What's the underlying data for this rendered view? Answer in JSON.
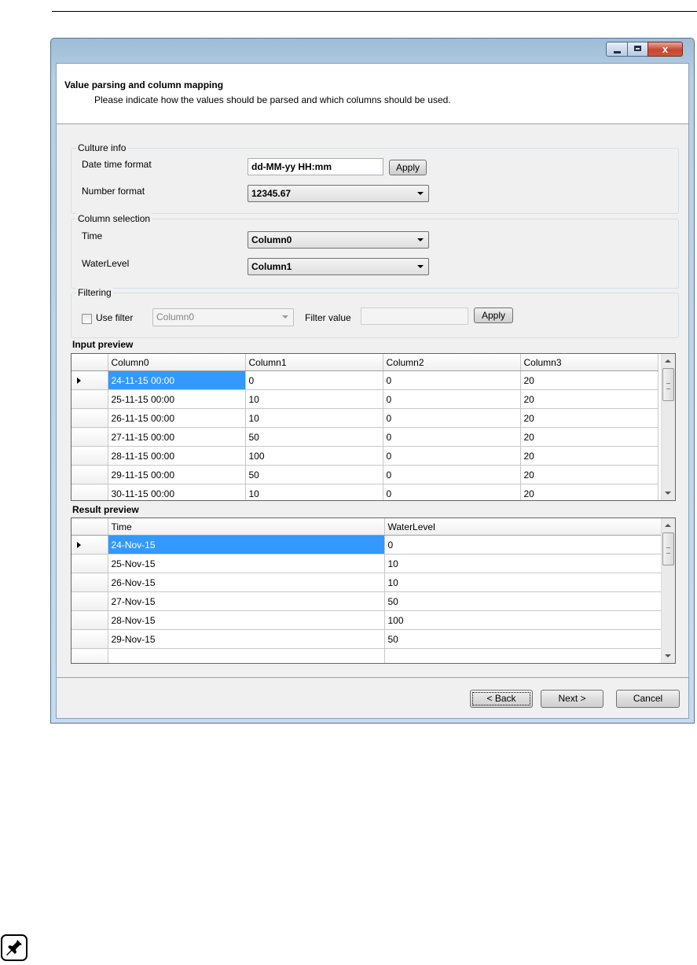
{
  "dialog": {
    "title": "Value parsing and column mapping",
    "subtitle": "Please indicate how the values should be parsed and which columns should be used."
  },
  "culture": {
    "legend": "Culture info",
    "datetime_label": "Date time format",
    "datetime_value": "dd-MM-yy HH:mm",
    "apply_label": "Apply",
    "number_label": "Number format",
    "number_value": "12345.67"
  },
  "columns": {
    "legend": "Column selection",
    "time_label": "Time",
    "time_value": "Column0",
    "water_label": "WaterLevel",
    "water_value": "Column1"
  },
  "filtering": {
    "legend": "Filtering",
    "use_filter_label": "Use filter",
    "use_filter_checked": false,
    "filter_column": "Column0",
    "filter_value_label": "Filter value",
    "filter_value": "",
    "apply_label": "Apply"
  },
  "input_preview": {
    "label": "Input preview",
    "headers": [
      "Column0",
      "Column1",
      "Column2",
      "Column3"
    ],
    "rows": [
      [
        "24-11-15 00:00",
        "0",
        "0",
        "20"
      ],
      [
        "25-11-15 00:00",
        "10",
        "0",
        "20"
      ],
      [
        "26-11-15 00:00",
        "10",
        "0",
        "20"
      ],
      [
        "27-11-15 00:00",
        "50",
        "0",
        "20"
      ],
      [
        "28-11-15 00:00",
        "100",
        "0",
        "20"
      ],
      [
        "29-11-15 00:00",
        "50",
        "0",
        "20"
      ],
      [
        "30-11-15 00:00",
        "10",
        "0",
        "20"
      ]
    ]
  },
  "result_preview": {
    "label": "Result preview",
    "headers": [
      "Time",
      "WaterLevel"
    ],
    "rows": [
      [
        "24-Nov-15",
        "0"
      ],
      [
        "25-Nov-15",
        "10"
      ],
      [
        "26-Nov-15",
        "10"
      ],
      [
        "27-Nov-15",
        "50"
      ],
      [
        "28-Nov-15",
        "100"
      ],
      [
        "29-Nov-15",
        "50"
      ],
      [
        "",
        ""
      ]
    ]
  },
  "footer": {
    "back_label": "< Back",
    "next_label": "Next >",
    "cancel_label": "Cancel"
  },
  "window": {
    "minimize_icon": "minimize-icon",
    "maximize_icon": "maximize-icon",
    "close_glyph": "x"
  },
  "note_icon": "pin-icon",
  "colors": {
    "selection": "#3399ff",
    "window_frame": "#b7d0e6"
  }
}
